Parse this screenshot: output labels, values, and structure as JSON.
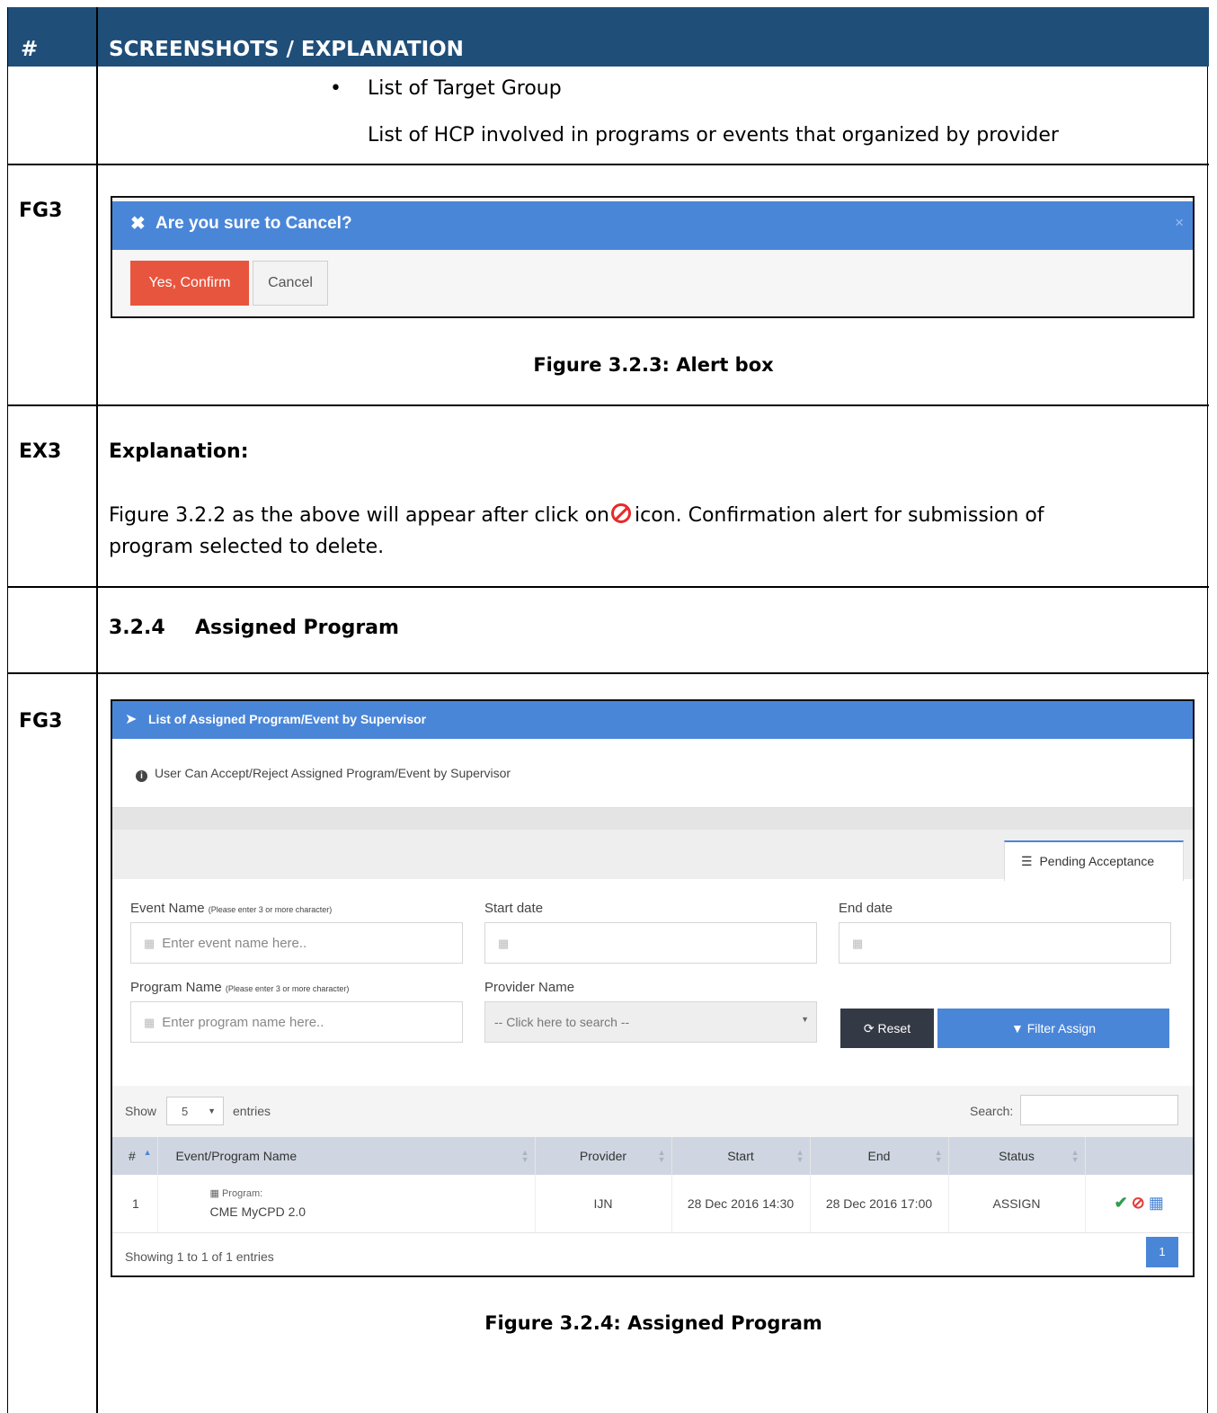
{
  "header": {
    "col1": "#",
    "col2": "SCREENSHOTS / EXPLANATION"
  },
  "row0": {
    "bullet_title": "List of Target Group",
    "bullet_text": "List of HCP involved in programs or events that organized by provider"
  },
  "fg3_alert": {
    "label": "FG3",
    "dialog_title": "Are you sure to Cancel?",
    "close_glyph": "×",
    "confirm_label": "Yes, Confirm",
    "cancel_label": "Cancel",
    "caption": "Figure 3.2.3: Alert box"
  },
  "ex3": {
    "label": "EX3",
    "heading": "Explanation:",
    "text_before_icon": "Figure 3.2.2 as the above will appear after click on",
    "text_after_icon": "icon. Confirmation alert for submission of",
    "text_line2": "program selected to delete."
  },
  "section": {
    "number": "3.2.4",
    "title": "Assigned Program"
  },
  "fg3_assigned": {
    "label": "FG3",
    "panel_title": "List of Assigned Program/Event by Supervisor",
    "info_text": "User Can Accept/Reject Assigned Program/Event by Supervisor",
    "tab_label": "Pending Acceptance",
    "filters": {
      "event_name_label": "Event Name",
      "event_name_hint": "(Please enter 3 or more character)",
      "event_name_placeholder": "Enter event name here..",
      "start_date_label": "Start date",
      "end_date_label": "End date",
      "program_name_label": "Program Name",
      "program_name_hint": "(Please enter 3 or more character)",
      "program_name_placeholder": "Enter program name here..",
      "provider_label": "Provider Name",
      "provider_placeholder": "-- Click here to search --",
      "reset_label": "Reset",
      "filter_label": "Filter Assign"
    },
    "table": {
      "show_label": "Show",
      "page_size": "5",
      "entries_label": "entries",
      "search_label": "Search:",
      "columns": [
        "#",
        "Event/Program Name",
        "Provider",
        "Start",
        "End",
        "Status"
      ],
      "rows": [
        {
          "num": "1",
          "tag": "Program:",
          "name": "CME MyCPD 2.0",
          "provider": "IJN",
          "start": "28 Dec 2016 14:30",
          "end": "28 Dec 2016 17:00",
          "status": "ASSIGN"
        }
      ],
      "showing_text": "Showing 1 to 1 of 1 entries",
      "current_page": "1"
    },
    "caption": "Figure 3.2.4: Assigned Program"
  }
}
